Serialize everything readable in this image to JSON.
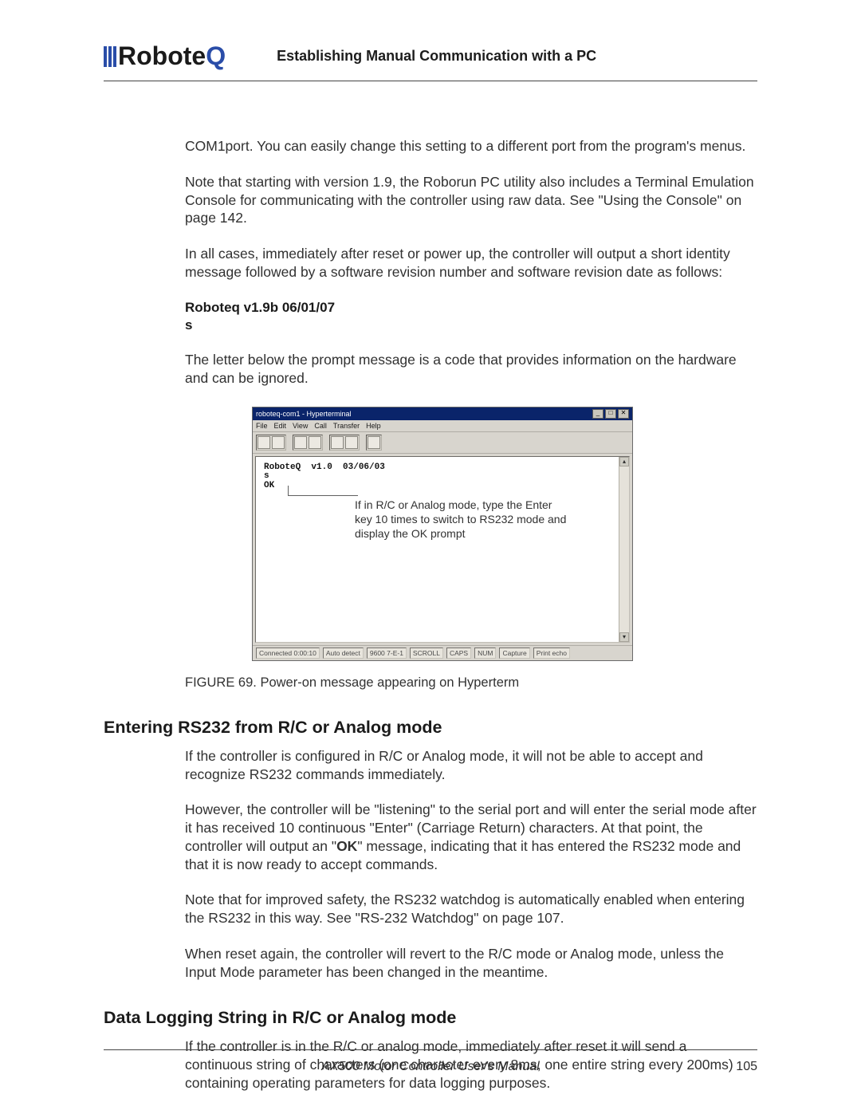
{
  "header": {
    "logo_text_pre": "Robote",
    "logo_text_q": "Q",
    "title": "Establishing Manual Communication with a PC"
  },
  "body": {
    "p1": "COM1port. You can easily change this setting to a different port from the program's menus.",
    "p2": "Note that starting with version 1.9, the Roborun PC utility also includes a Terminal Emulation Console for communicating with the controller using raw data. See \"Using the Console\" on page 142.",
    "p3": "In all cases, immediately after reset or power up, the controller will output a short identity message followed by a software revision number and software revision date as follows:",
    "version_line1": "Roboteq v1.9b 06/01/07",
    "version_line2": "s",
    "p4": "The letter below the prompt message is a code that provides information on the hardware and can be ignored."
  },
  "hyperterm": {
    "window_title": "roboteq-com1 - Hyperterminal",
    "menu": [
      "File",
      "Edit",
      "View",
      "Call",
      "Transfer",
      "Help"
    ],
    "term_line1": "RoboteQ  v1.0  03/06/03",
    "term_line2": "s",
    "term_line3": "OK",
    "overlay": "If in R/C or Analog mode, type the Enter key 10 times to switch to RS232 mode and display the OK prompt",
    "status": [
      "Connected 0:00:10",
      "Auto detect",
      "9600 7-E-1",
      "SCROLL",
      "CAPS",
      "NUM",
      "Capture",
      "Print echo"
    ]
  },
  "fig_caption": "FIGURE 69.  Power-on message appearing on Hyperterm",
  "section1": {
    "title": "Entering RS232 from R/C or Analog mode",
    "p1": "If the controller is configured in R/C or Analog mode, it will not be able to accept and recognize RS232 commands immediately.",
    "p2_a": "However, the controller will be \"listening\" to the serial port and will enter the serial mode after it has received 10 continuous \"Enter\" (Carriage Return) characters. At that point, the controller will output an \"",
    "p2_ok": "OK",
    "p2_b": "\" message, indicating that it has entered the RS232 mode and that it is now ready to accept commands.",
    "p3": "Note that for improved safety, the RS232 watchdog is automatically enabled when entering the RS232 in this way. See \"RS-232 Watchdog\" on page 107.",
    "p4": "When reset again, the controller will revert to the R/C mode or Analog mode, unless the Input Mode parameter has been changed in the meantime."
  },
  "section2": {
    "title": "Data Logging String in R/C or Analog mode",
    "p1": "If the controller is in the R/C or analog mode, immediately after reset it will send a continuous string of characters (one character every 8ms, one entire string every 200ms) containing operating parameters for data logging purposes."
  },
  "footer": {
    "title": "AX500 Motor Controller User's Manual",
    "page": "105"
  }
}
